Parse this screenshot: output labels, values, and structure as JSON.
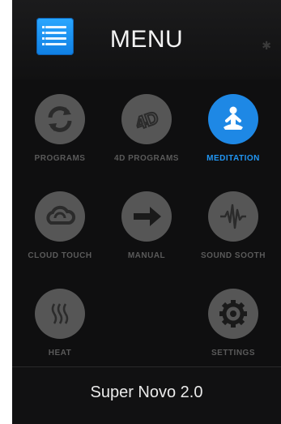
{
  "header": {
    "title": "MENU",
    "menu_icon": "list-icon",
    "status_icon": "bluetooth-icon"
  },
  "tiles": [
    {
      "label": "PROGRAMS",
      "icon": "refresh-icon",
      "active": false
    },
    {
      "label": "4D PROGRAMS",
      "icon": "4d-icon",
      "active": false
    },
    {
      "label": "MEDITATION",
      "icon": "meditation-icon",
      "active": true
    },
    {
      "label": "CLOUD TOUCH",
      "icon": "cloud-icon",
      "active": false
    },
    {
      "label": "MANUAL",
      "icon": "arrow-right-icon",
      "active": false
    },
    {
      "label": "SOUND SOOTH",
      "icon": "sound-wave-icon",
      "active": false
    },
    {
      "label": "HEAT",
      "icon": "heat-icon",
      "active": false
    },
    {
      "label": "SETTINGS",
      "icon": "gear-icon",
      "active": false
    }
  ],
  "footer": {
    "device_name": "Super Novo 2.0"
  },
  "colors": {
    "accent": "#1e88e5",
    "icon_bg": "#565656",
    "background": "#0f0f10"
  }
}
